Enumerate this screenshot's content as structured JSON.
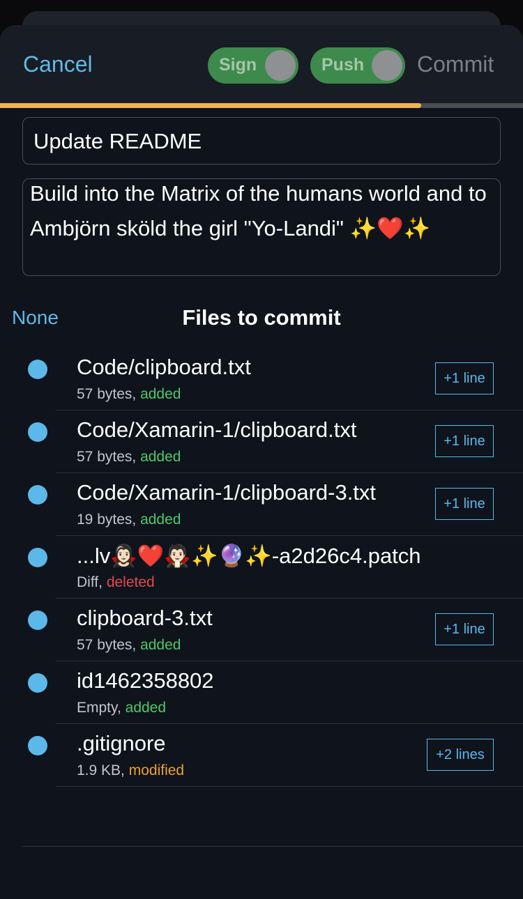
{
  "nav": {
    "cancel_label": "Cancel",
    "sign_label": "Sign",
    "push_label": "Push",
    "commit_label": "Commit",
    "sign_on": false,
    "push_on": false
  },
  "progress": {
    "fraction": 0.805,
    "color": "#f2b44f"
  },
  "commit_message": {
    "title": "Update README",
    "body": "Build into the Matrix of the humans world and to Ambjörn sköld the girl \"Yo-Landi\" ✨❤️✨"
  },
  "files_section": {
    "none_label": "None",
    "title": "Files to commit"
  },
  "files": [
    {
      "name": "Code/clipboard.txt",
      "size": "57 bytes,",
      "status": "added",
      "lines": "+1 line"
    },
    {
      "name": "Code/Xamarin-1/clipboard.txt",
      "size": "57 bytes,",
      "status": "added",
      "lines": "+1 line"
    },
    {
      "name": "Code/Xamarin-1/clipboard-3.txt",
      "size": "19 bytes,",
      "status": "added",
      "lines": "+1 line"
    },
    {
      "name": "...lv🧛🏻‍♀️❤️🧛🏻✨🔮✨-a2d26c4.patch",
      "size": "Diff,",
      "status": "deleted",
      "lines": ""
    },
    {
      "name": "clipboard-3.txt",
      "size": "57 bytes,",
      "status": "added",
      "lines": "+1 line"
    },
    {
      "name": "id1462358802",
      "size": "Empty,",
      "status": "added",
      "lines": ""
    },
    {
      "name": ".gitignore",
      "size": "1.9 KB,",
      "status": "modified",
      "lines": "+2 lines"
    }
  ],
  "colors": {
    "accent": "#63b8e8",
    "added": "#4cc96a",
    "deleted": "#e5484d",
    "modified": "#f0a030",
    "toggle_green": "#3d8a4c"
  },
  "icons": {
    "file_dot": "selected-dot-icon",
    "toggle_knob": "toggle-knob-icon"
  }
}
